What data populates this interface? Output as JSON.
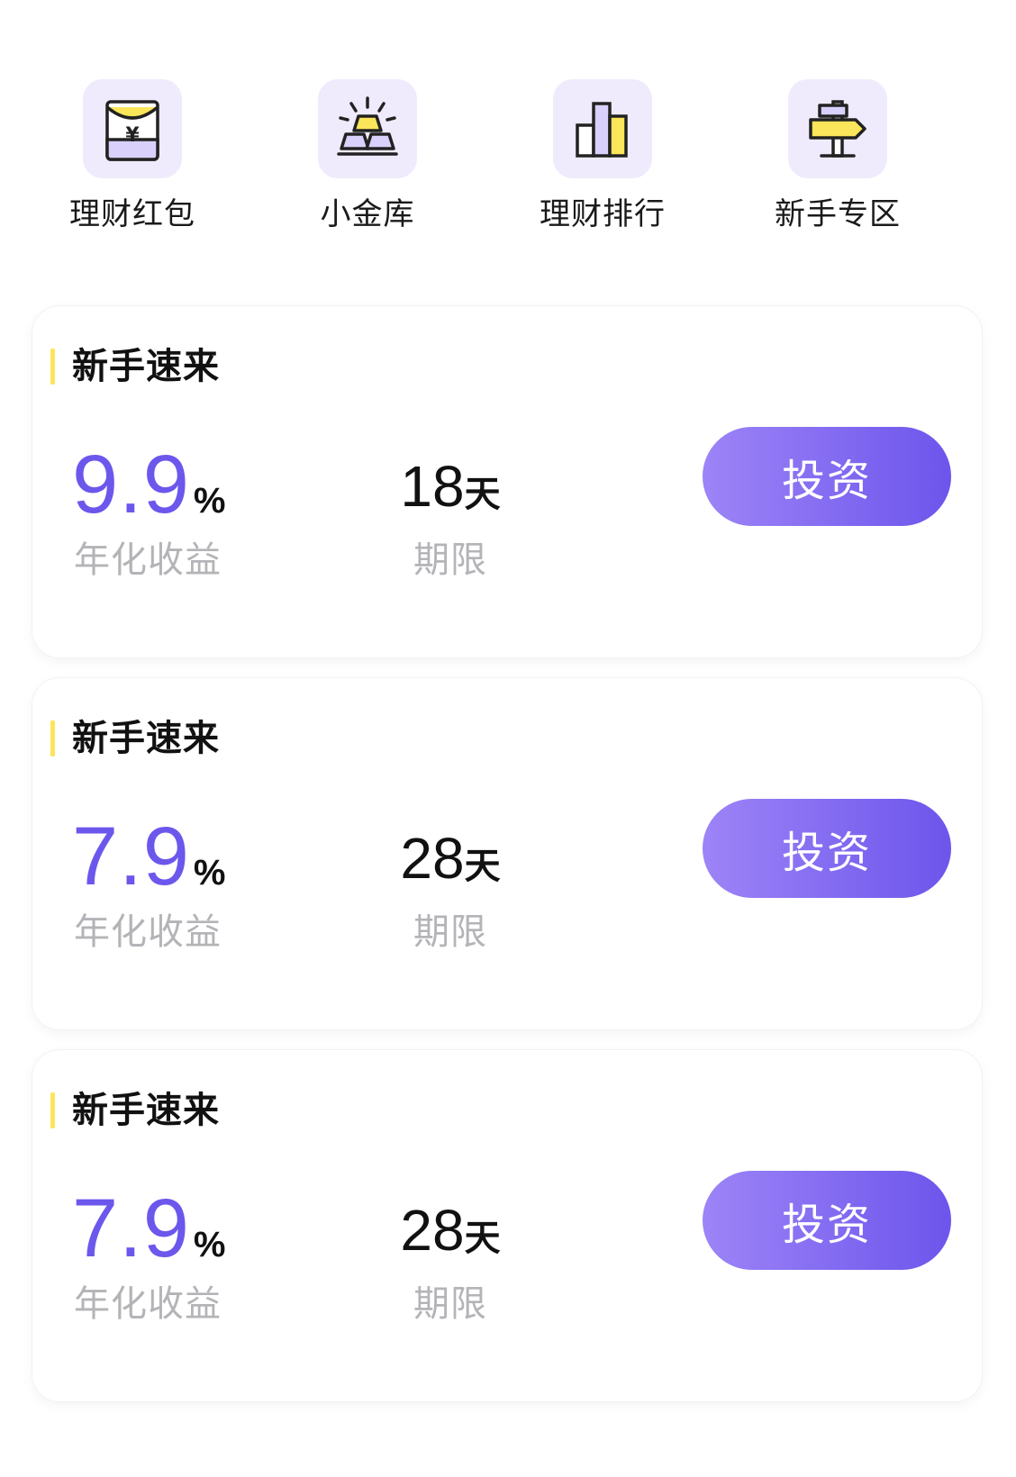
{
  "colors": {
    "accent_purple": "#6c57ec",
    "button_gradient_start": "#9d84f7",
    "button_gradient_end": "#6d55ec",
    "title_accent_yellow": "#fbe55a",
    "icon_tile_bg": "#efebfc",
    "caption_gray": "#b4b4b8"
  },
  "shortcuts": [
    {
      "label": "理财红包",
      "icon": "red-envelope-icon"
    },
    {
      "label": "小金库",
      "icon": "gold-bars-icon"
    },
    {
      "label": "理财排行",
      "icon": "ranking-bars-icon"
    },
    {
      "label": "新手专区",
      "icon": "signpost-icon"
    }
  ],
  "products": [
    {
      "title": "新手速来",
      "rate": "9.9",
      "rate_unit": "%",
      "rate_caption": "年化收益",
      "term": "18",
      "term_unit": "天",
      "term_caption": "期限",
      "button_label": "投资"
    },
    {
      "title": "新手速来",
      "rate": "7.9",
      "rate_unit": "%",
      "rate_caption": "年化收益",
      "term": "28",
      "term_unit": "天",
      "term_caption": "期限",
      "button_label": "投资"
    },
    {
      "title": "新手速来",
      "rate": "7.9",
      "rate_unit": "%",
      "rate_caption": "年化收益",
      "term": "28",
      "term_unit": "天",
      "term_caption": "期限",
      "button_label": "投资"
    }
  ]
}
